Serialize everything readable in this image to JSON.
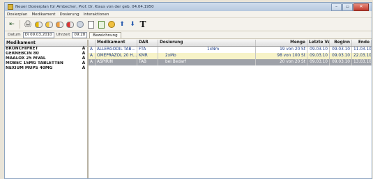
{
  "window": {
    "title": "Neuer Dosierplan für Ambecher, Prof. Dr. Klaus von der geb. 04.04.1950",
    "controls": [
      "–",
      "▭",
      "✕"
    ]
  },
  "menu": [
    "Dosierplan",
    "Medikament",
    "Dosierung",
    "Interaktionen"
  ],
  "toolbar": {
    "icons": [
      "exit-icon",
      "print-icon",
      "pill-a-icon",
      "pill-b-icon",
      "pill-c-icon",
      "pill-d-icon",
      "capsule-icon",
      "document-icon",
      "document-add-icon",
      "pill-stack-icon",
      "arrow-up-icon",
      "arrow-down-icon",
      "text-icon"
    ],
    "glyphs": [
      "⇤",
      "🖨",
      "💊",
      "💊",
      "💊",
      "💊",
      "◖",
      "▤",
      "▦",
      "◉",
      "⬆",
      "⬇",
      "T"
    ]
  },
  "datebar": {
    "date_label": "Datum",
    "date_value": "Di 09.03.2010",
    "time_label": "Uhrzeit",
    "time_value": "09:28",
    "tab_label": "Bezeichnung"
  },
  "left": {
    "header": "Medikament",
    "items": [
      {
        "name": "BRONCHIPRET",
        "flag": "A"
      },
      {
        "name": "GERNEBCIN 80",
        "flag": "A"
      },
      {
        "name": "MAALOX 25 MVAL",
        "flag": "A"
      },
      {
        "name": "MOBEC 15MG TABLETTEN",
        "flag": "A"
      },
      {
        "name": "NEXIUM MUPS 40MG",
        "flag": "A"
      }
    ]
  },
  "grid": {
    "headers": [
      "",
      "Medikament",
      "DAR",
      "Dosierung",
      "Menge",
      "Letzte Ver.",
      "Beginn",
      "Ende"
    ],
    "rows": [
      [
        "A",
        "ALLERGODIL TAB...",
        "FTA",
        "1xNm",
        "19 von 20 St",
        "09.03.10",
        "09.03.10",
        "11.03.10"
      ],
      [
        "A",
        "OMEPRAZOL 20 H...",
        "KMR",
        "2xMo",
        "98 von 100 St",
        "09.03.10",
        "09.03.10",
        "22.03.10"
      ],
      [
        "A",
        "ASPIRIN",
        "TAB",
        "bei Bedarf",
        "20 von 20 St",
        "09.03.10",
        "09.03.10",
        "13.03.10"
      ]
    ]
  }
}
